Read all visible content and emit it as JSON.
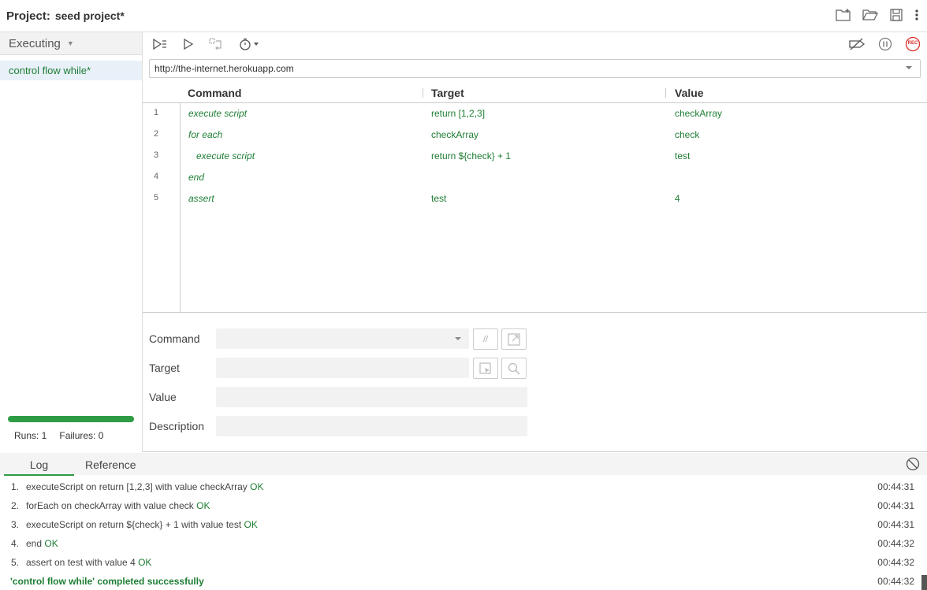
{
  "header": {
    "project_label": "Project:",
    "project_name": "seed project*",
    "icons": [
      "new-folder-icon",
      "open-folder-icon",
      "save-icon",
      "more-vert-icon"
    ]
  },
  "sidebar": {
    "mode": "Executing",
    "tests": [
      {
        "label": "control flow while*"
      }
    ],
    "progress": 1.0,
    "runs_text": "Runs: 1",
    "failures_text": "Failures: 0"
  },
  "toolbar": {
    "left_icons": [
      "run-all-icon",
      "run-current-icon",
      "step-icon",
      "speed-icon"
    ],
    "right_icons": [
      "disable-breakpoints-icon",
      "pause-icon",
      "record-icon"
    ],
    "rec_label": "REC"
  },
  "url": {
    "value": "http://the-internet.herokuapp.com"
  },
  "table": {
    "headers": {
      "command": "Command",
      "target": "Target",
      "value": "Value"
    },
    "rows": [
      {
        "num": "1",
        "command": "execute script",
        "target": "return [1,2,3]",
        "value": "checkArray"
      },
      {
        "num": "2",
        "command": "for each",
        "target": "checkArray",
        "value": "check"
      },
      {
        "num": "3",
        "command": "execute script",
        "target": "return ${check} + 1",
        "value": "test"
      },
      {
        "num": "4",
        "command": "end",
        "target": "",
        "value": ""
      },
      {
        "num": "5",
        "command": "assert",
        "target": "test",
        "value": "4"
      }
    ]
  },
  "editor": {
    "command_label": "Command",
    "target_label": "Target",
    "value_label": "Value",
    "description_label": "Description",
    "comment_btn": "//"
  },
  "log": {
    "tabs": [
      "Log",
      "Reference"
    ],
    "entries": [
      {
        "n": "1.",
        "text": "executeScript on return [1,2,3] with value checkArray",
        "status": "OK",
        "time": "00:44:31"
      },
      {
        "n": "2.",
        "text": "forEach on checkArray with value check",
        "status": "OK",
        "time": "00:44:31"
      },
      {
        "n": "3.",
        "text": "executeScript on return ${check} + 1 with value test",
        "status": "OK",
        "time": "00:44:31"
      },
      {
        "n": "4.",
        "text": "end",
        "status": "OK",
        "time": "00:44:32"
      },
      {
        "n": "5.",
        "text": "assert on test with value 4",
        "status": "OK",
        "time": "00:44:32"
      }
    ],
    "summary": "'control flow while' completed successfully",
    "summary_time": "00:44:32"
  },
  "colors": {
    "accent": "#2e9c44",
    "green_text": "#1e7e34",
    "rec_red": "#d9302c"
  }
}
